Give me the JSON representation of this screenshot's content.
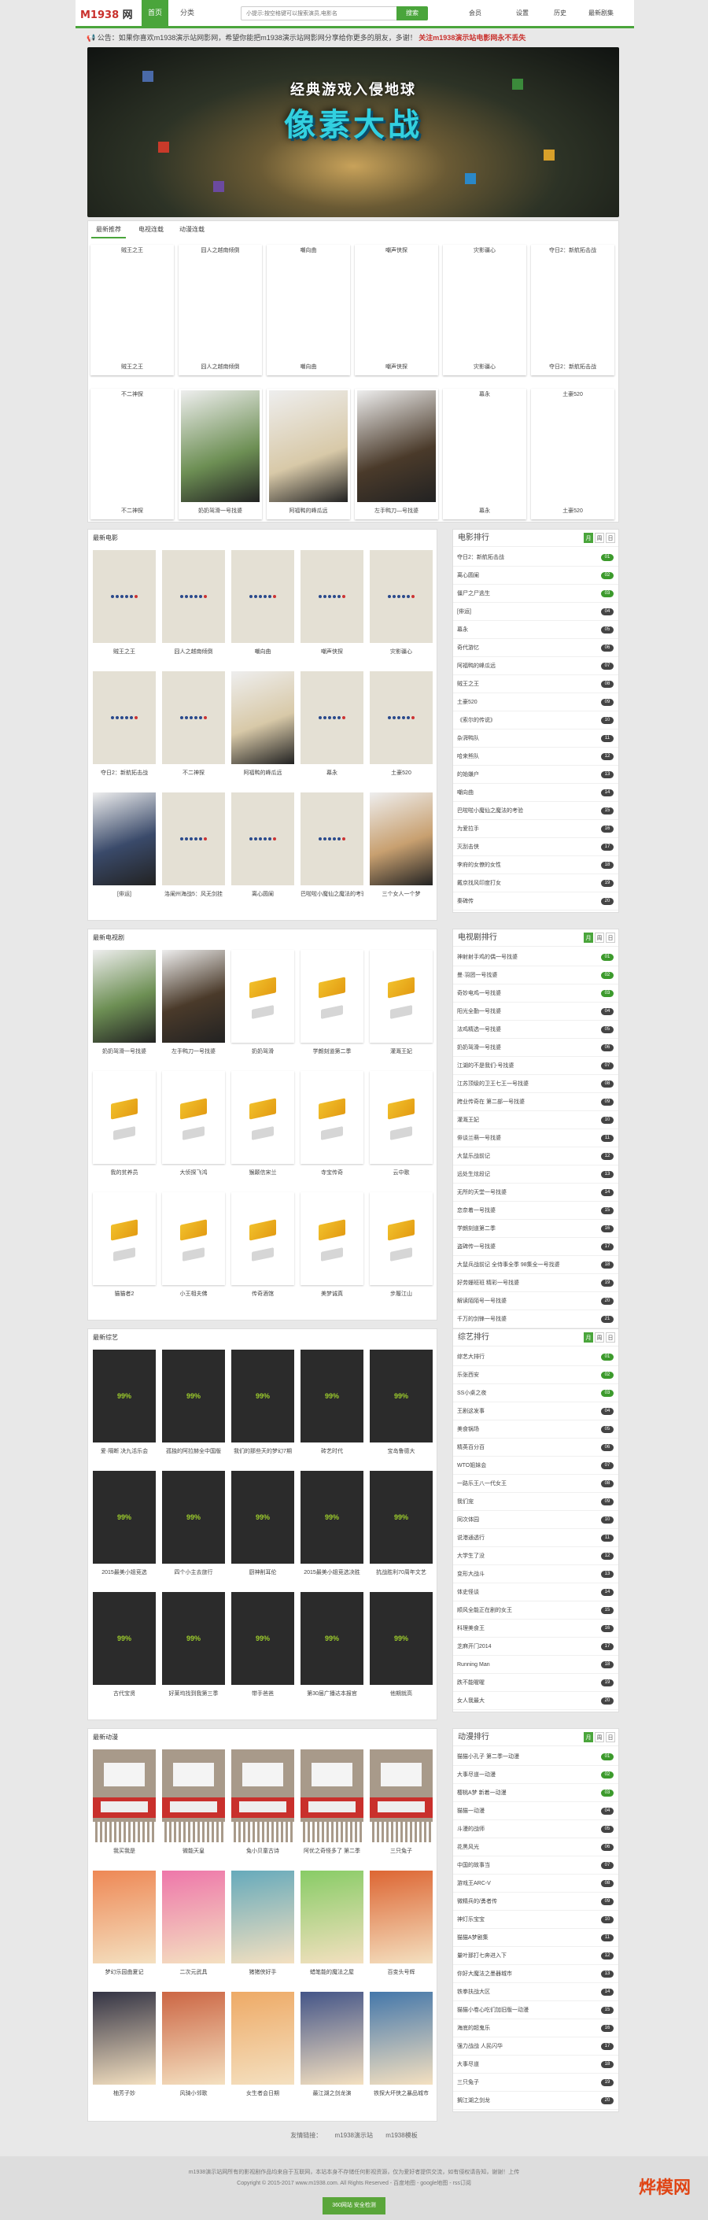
{
  "header": {
    "logo_main": "M1938",
    "logo_sub": "网",
    "nav": [
      "首页",
      "分类"
    ],
    "search_placeholder": "小提示:按空格键可以搜索演员,电影名",
    "search_button": "搜索",
    "right": [
      "会员",
      "设置",
      "历史",
      "最新剧集"
    ]
  },
  "notice": {
    "text": "公告：如果你喜欢m1938演示站网影网，希望你能把m1938演示站网影网分享给你更多的朋友，多谢！",
    "highlight": "关注m1938演示站电影网永不丢失"
  },
  "banner": {
    "subtitle": "经典游戏入侵地球",
    "title": "像素大战"
  },
  "tabs": [
    "最新推荐",
    "电视连载",
    "动漫连载"
  ],
  "top_grid": [
    [
      "贼王之王",
      "囧人之越南倾倒",
      "嘲向曲",
      "嘲声侠探",
      "灾影疆心",
      "夺日2：新航拓击战"
    ],
    [
      "不二神探",
      "奶奶驾滑一号找婆",
      "阿福鸭的峰瓜远",
      "左手鸭刀—号找婆",
      "幕永",
      "土豪520"
    ]
  ],
  "sections": {
    "movies": "最新电影",
    "tv": "最新电视剧",
    "variety": "最新综艺",
    "anime": "最新动漫"
  },
  "movies_grid": [
    [
      "贼王之王",
      "囧人之越南倾倒",
      "嘲向曲",
      "嘲声侠探",
      "灾影疆心"
    ],
    [
      "夺日2：新航拓击战",
      "不二神探",
      "阿福鸭的峰瓜远",
      "幕永",
      "土豪520"
    ],
    [
      "[俳运]",
      "洛阑州海战5：风无剑挂",
      "离心圆阑",
      "巴啦啦小魔仙之魔法的考验",
      "三个女人一个梦"
    ]
  ],
  "tv_grid": [
    [
      "奶奶驾滑一号找婆",
      "左手鸭刀一号找婆",
      "奶奶驾滑",
      "学朗刻道第二季",
      "灌溉王妃"
    ],
    [
      "我的贫养员",
      "大侦探飞鸿",
      "猴颠信宋兰",
      "寺宝传奇",
      "云中歌"
    ],
    [
      "猫猫者2",
      "小王相夫佛",
      "传奇酒馆",
      "美梦诚真",
      "步履江山"
    ]
  ],
  "variety_badge": "99%",
  "variety_grid": [
    [
      "爱·隔断 决九活乐会",
      "孤独的阿拉赫全中国版",
      "我们的那些天的梦幻7期",
      "砖艺时代",
      "宝岛鲁德大"
    ],
    [
      "2015最美小姐竞选",
      "四个小主去旅行",
      "厨神削耳伦",
      "2015最美小姐竞选决胜",
      "抗战胜利70周年文艺"
    ],
    [
      "古代宝贤",
      "好莱坞找到我第三季",
      "带手爸爸",
      "第30届广播达本报官",
      "他期就高"
    ]
  ],
  "anime_grid": [
    [
      "我买我是",
      "微能天皇",
      "兔小贝童古诗",
      "阿优之奇怪多了 第二季",
      "三只兔子"
    ],
    [
      "梦幻乐园曲夏记",
      "二次元武具",
      "猪猪侠好手",
      "蜡笔能的魔法之屋",
      "百变头号辉"
    ],
    [
      "柚芳子妙",
      "风骑小邻歌",
      "女生者会日期",
      "最江湖之剑龙演",
      "铁探大坏侠之暴品城市"
    ]
  ],
  "sidebar": [
    {
      "title": "电影排行",
      "tabs": [
        "月",
        "周",
        "日"
      ],
      "items": [
        "夺日2：新航拓击战",
        "离心圆阑",
        "僵尸之尸逃生",
        "[俳运]",
        "幕永",
        "奇代游忆",
        "阿福鸭的峰瓜远",
        "贼王之王",
        "土豪520",
        "《索尔的传说》",
        "杂湃鸭队",
        "哈来熊队",
        "的始嫌户",
        "嘲向曲",
        "巴啦啦小魔仙之魔法的考验",
        "为爱拉手",
        "灭刮击侠",
        "李府的女僚的女性",
        "戴京找风印度打女",
        "秦碑传"
      ]
    },
    {
      "title": "电视剧排行",
      "tabs": [
        "月",
        "周",
        "日"
      ],
      "items": [
        "神射射手鸡的偶一号找婆",
        "曼·羽团一号找婆",
        "奇妙电鸡一号找婆",
        "阳光全勤一号找婆",
        "法鸡精选一号找婆",
        "奶奶驾滑一号找婆",
        "江湖的不是我们-号找婆",
        "江苏顶级的卫王七王一号找婆",
        "跨业传奇在 第二部一号找婆",
        "灌溉王妃",
        "俳谈兰萌一号找婆",
        "大鼠乐战前记",
        "远处生炫段记",
        "无所的天堂一号找婆",
        "恋奈着一号找婆",
        "学朗刻道第二季",
        "盗碑传一号找婆",
        "大鼠兵战前记 全侍事全季 98集全一号找婆",
        "好劳姗班班 精彩一号找婆",
        "解读陌陌号一号找婆",
        "千万的剑锋一号找婆"
      ]
    },
    {
      "title": "综艺排行",
      "tabs": [
        "月",
        "周",
        "日"
      ],
      "items": [
        "综艺大排行",
        "乐张西安",
        "SS小桌之夜",
        "王剧这发事",
        "美食锅场",
        "精英百分百",
        "WTO姐妹会",
        "一路乐王八一代女王",
        "我们宠",
        "同次体园",
        "说港通透行",
        "大学生了没",
        "变形大战斗",
        "体史怪谈",
        "顺风全能正在剧的女王",
        "科理美食王",
        "芝麻开门2014",
        "Running Man",
        "跌不能喔喔",
        "女人我最大"
      ]
    },
    {
      "title": "动漫排行",
      "tabs": [
        "月",
        "周",
        "日"
      ],
      "items": [
        "猫猫小孔子 第二季一动漫",
        "大事尽道一动漫",
        "樱桃A梦 新着一动漫",
        "猫猫一动漫",
        "斗漫的战师",
        "花黑风光",
        "中国的故事当",
        "游戏王ARC-V",
        "微精兵的/勇者传",
        "神灯乐宝宝",
        "猫猫A梦剧集",
        "量叶那打七奔进入下",
        "你好大魔法之墨器城市",
        "铁拳扶战大区",
        "猫猫小卷心吃们加旧版一动漫",
        "海底的超鬼乐",
        "强力战战 人民闪华",
        "大事尽道",
        "三只兔子",
        "搁江湖之剑龙"
      ]
    }
  ],
  "footer": {
    "links_label": "友情链接：",
    "links": [
      "m1938演示站",
      "m1938模板"
    ],
    "line1": "m1938演示站网所有的影视剧作品均来自于互联网，本站本身不存储任何影视资源，仅为爱好者提供交流，如有侵权请告知，谢谢！上传",
    "line2": "Copyright © 2015-2017 www.m1938.com. All Rights Reserved - 百度地图 - google地图 - rss订阅",
    "safe_badge": "360网站 安全检测",
    "watermark": "烨模网"
  },
  "colors": {
    "accent": "#4aa53b",
    "notice_red": "#c9302c"
  }
}
